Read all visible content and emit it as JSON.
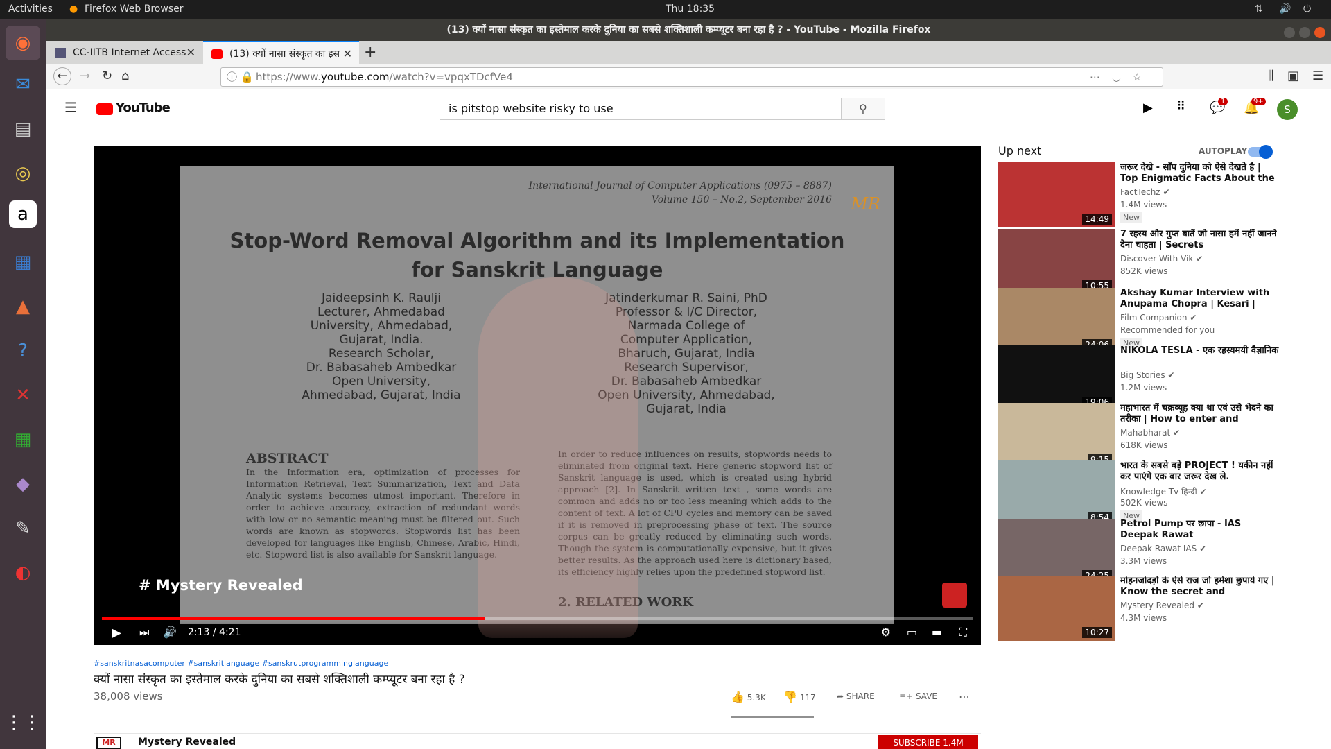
{
  "os": {
    "activities": "Activities",
    "app_menu": "Firefox Web Browser",
    "clock": "Thu 18:35"
  },
  "window": {
    "title": "(13) क्यों नासा संस्कृत का इस्तेमाल करके दुनिया का सबसे शक्तिशाली कम्प्यूटर बना रहा है ? - YouTube - Mozilla Firefox"
  },
  "tabs": [
    {
      "label": "CC-IITB Internet Access"
    },
    {
      "label": "(13) क्यों नासा संस्कृत का इस"
    }
  ],
  "url": {
    "prefix": "https://www.",
    "host": "youtube.com",
    "path": "/watch?v=vpqxTDcfVe4"
  },
  "youtube": {
    "logo": "YouTube",
    "search_value": "is pitstop website  risky to use",
    "notif1": "1",
    "notif2": "9+",
    "avatar": "S"
  },
  "video": {
    "journal": "International Journal of Computer Applications (0975 – 8887)",
    "volume": "Volume 150 – No.2, September 2016",
    "paper_title1": "Stop-Word Removal Algorithm and its Implementation",
    "paper_title2": "for Sanskrit Language",
    "author1": [
      "Jaideepsinh K. Raulji",
      "Lecturer, Ahmedabad",
      "University, Ahmedabad,",
      "Gujarat, India.",
      "Research Scholar,",
      "Dr. Babasaheb Ambedkar",
      "Open University,",
      "Ahmedabad, Gujarat, India"
    ],
    "author2": [
      "Jatinderkumar R. Saini, PhD",
      "Professor & I/C Director,",
      "Narmada College of",
      "Computer Application,",
      "Bharuch, Gujarat, India",
      "Research Supervisor,",
      "Dr. Babasaheb Ambedkar",
      "Open University, Ahmedabad,",
      "Gujarat, India"
    ],
    "abstract_head": "ABSTRACT",
    "abstract_text": "In the Information era, optimization of processes for Information Retrieval, Text Summarization, Text and Data Analytic systems becomes utmost important. Therefore in order to achieve accuracy, extraction of redundant words with low or no semantic meaning must be filtered out. Such words are known as stopwords. Stopwords list has been developed for languages like English, Chinese, Arabic, Hindi, etc. Stopword list is also available for Sanskrit language.",
    "right_text": "In order to reduce influences on results, stopwords needs to eliminated from original text. Here generic stopword list of Sanskrit language is used, which is created using hybrid approach [2]. In Sanskrit written text , some words are common and adds no or too less meaning which adds to the content of text. A lot of CPU cycles and memory can be saved if it is removed in preprocessing phase of text. The source corpus can be greatly reduced by eliminating such words. Though the system is computationally expensive, but it gives better results. As the approach used here is dictionary based, its efficiency highly relies upon the predefined stopword list.",
    "related_head": "2.  RELATED WORK",
    "watermark": "# Mystery Revealed",
    "badge_logo": "MR",
    "time": "2:13 / 4:21",
    "progress_fraction": 0.44
  },
  "meta": {
    "hashtags": "#sanskritnasacomputer #sanskritlanguage #sanskrutprogramminglanguage",
    "title": "क्यों नासा संस्कृत का इस्तेमाल करके दुनिया का सबसे शक्तिशाली कम्प्यूटर बना रहा है ?",
    "views": "38,008 views",
    "likes": "5.3K",
    "dislikes": "117",
    "share": "SHARE",
    "save": "SAVE",
    "channel": "Mystery Revealed",
    "subscribe": "SUBSCRIBE 1.4M"
  },
  "upnext": {
    "label": "Up next",
    "autoplay": "AUTOPLAY",
    "items": [
      {
        "title": "जरूर देखे - साँप दुनिया को ऐसे देखते है | Top Enigmatic Facts About the",
        "channel": "FactTechz",
        "views": "1.4M views",
        "badge": "New",
        "duration": "14:49",
        "color": "#b33"
      },
      {
        "title": "7 रहस्य और गुप्त बातें जो नासा हमें नहीं जानने देना चाहता | Secrets",
        "channel": "Discover With Vik",
        "views": "852K views",
        "badge": "",
        "duration": "10:55",
        "color": "#844"
      },
      {
        "title": "Akshay Kumar Interview with Anupama Chopra | Kesari | Film",
        "channel": "Film Companion",
        "views": "Recommended for you",
        "badge": "New",
        "duration": "24:06",
        "color": "#a86"
      },
      {
        "title": "NIKOLA TESLA - एक रहस्यमयी वैज्ञानिक",
        "channel": "Big Stories",
        "views": "1.2M views",
        "badge": "",
        "duration": "19:06",
        "color": "#111"
      },
      {
        "title": "महाभारत में चक्रव्यूह क्या था एवं उसे भेदने का तरीका | How to enter and",
        "channel": "Mahabharat",
        "views": "618K views",
        "badge": "",
        "duration": "9:15",
        "color": "#c9b89a"
      },
      {
        "title": "भारत के सबसे बड़े PROJECT ! यकीन नहीं कर पाएंगे एक बार जरूर देख ले.",
        "channel": "Knowledge Tv हिन्दी",
        "views": "502K views",
        "badge": "New",
        "duration": "8:54",
        "color": "#9aa"
      },
      {
        "title": "Petrol Pump पर छापा - IAS Deepak Rawat",
        "channel": "Deepak Rawat IAS",
        "views": "3.3M views",
        "badge": "",
        "duration": "24:25",
        "color": "#766"
      },
      {
        "title": "मोहनजोदड़ो के ऐसे राज जो हमेशा छुपाये गए | Know the secret and",
        "channel": "Mystery Revealed",
        "views": "4.3M views",
        "badge": "",
        "duration": "10:27",
        "color": "#a64"
      }
    ]
  }
}
